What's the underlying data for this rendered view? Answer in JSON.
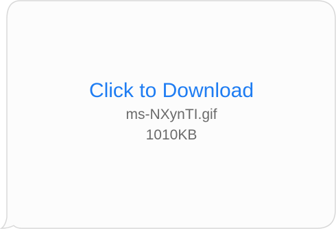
{
  "attachment": {
    "action_label": "Click to Download",
    "file_name": "ms-NXynTI.gif",
    "file_size": "1010KB"
  },
  "colors": {
    "link": "#1e7cf2",
    "meta_text": "#6b6b6b",
    "bubble_background": "#fcfcfc",
    "bubble_border": "#d8d8d8"
  }
}
